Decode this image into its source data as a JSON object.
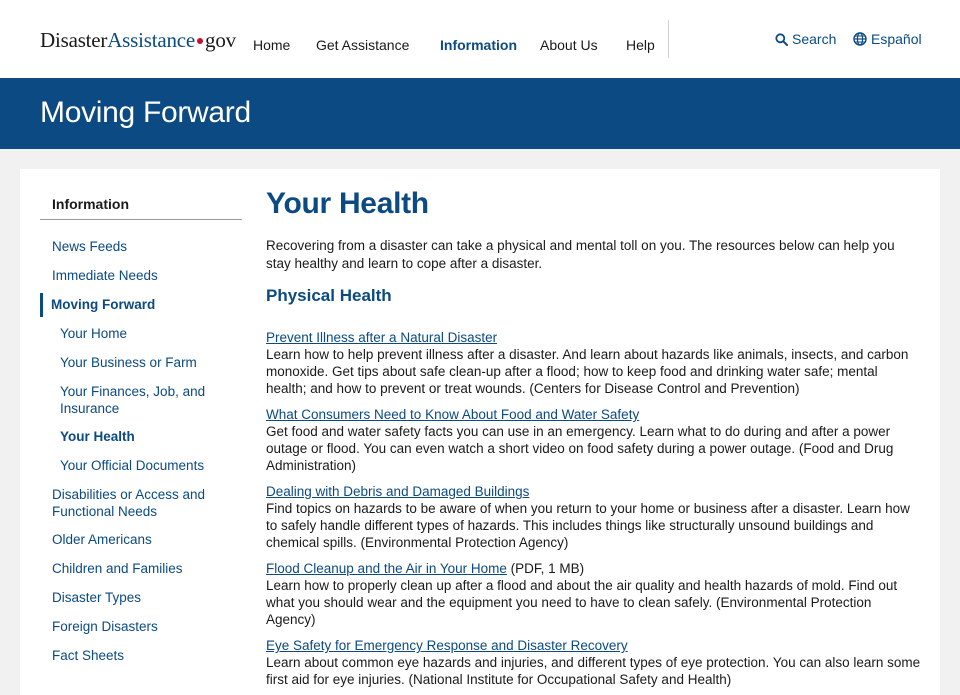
{
  "header": {
    "logo": {
      "part1": "Disaster",
      "part2": "Assistance",
      "part3": "gov"
    },
    "nav": [
      "Home",
      "Get Assistance",
      "Information",
      "About Us",
      "Help"
    ],
    "active_nav": "Information",
    "search_label": "Search",
    "language_label": "Español"
  },
  "banner": {
    "title": "Moving Forward"
  },
  "sidebar": {
    "heading": "Information",
    "items": [
      "News Feeds",
      "Immediate Needs",
      "Moving Forward",
      "Your Home",
      "Your Business or Farm",
      "Your Finances, Job, and Insurance",
      "Your Health",
      "Your Official Documents",
      "Disabilities or Access and Functional Needs",
      "Older Americans",
      "Children and Families",
      "Disaster Types",
      "Foreign Disasters",
      "Fact Sheets"
    ]
  },
  "main": {
    "title": "Your Health",
    "intro": "Recovering from a disaster can take a physical and mental toll on you. The resources below can help you stay healthy and learn to cope after a disaster.",
    "section_heading": "Physical Health",
    "resources": [
      {
        "link": "Prevent Illness after a Natural Disaster",
        "suffix": "",
        "description": "Learn how to help prevent illness after a disaster. And learn about hazards like animals, insects, and carbon monoxide. Get tips about safe clean-up after a flood; how to keep food and drinking water safe; mental health; and how to prevent or treat wounds. (Centers for Disease Control and Prevention)"
      },
      {
        "link": "What Consumers Need to Know About Food and Water Safety",
        "suffix": "",
        "description": "Get food and water safety facts you can use in an emergency. Learn what to do during and after a power outage or flood. You can even watch a short video on food safety during a power outage. (Food and Drug Administration)"
      },
      {
        "link": "Dealing with Debris and Damaged Buildings",
        "suffix": "",
        "description": "Find topics on hazards to be aware of when you return to your home or business after a disaster. Learn how to safely handle different types of hazards. This includes things like structurally unsound buildings and chemical spills. (Environmental Protection Agency)"
      },
      {
        "link": "Flood Cleanup and the Air in Your Home",
        "suffix": " (PDF, 1 MB)",
        "description": "Learn how to properly clean up after a flood and about the air quality and health hazards of mold. Find out what you should wear and the equipment you need to have to clean safely. (Environmental Protection Agency)"
      },
      {
        "link": "Eye Safety for Emergency Response and Disaster Recovery",
        "suffix": "",
        "description": "Learn about common eye hazards and injuries, and different types of eye protection. You can also learn some first aid for eye injuries. (National Institute for Occupational Safety and Health)"
      }
    ]
  },
  "colors": {
    "brand_blue": "#0b4a82",
    "logo_dot": "#c8102e",
    "page_bg": "#f1f1f1"
  }
}
